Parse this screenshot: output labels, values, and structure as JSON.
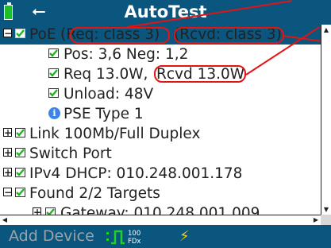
{
  "title_bar": {
    "title": "AutoTest",
    "battery_icon": "battery-icon",
    "usb_icon": "usb-icon",
    "usb_glyph": "⭠"
  },
  "tree": {
    "poe": {
      "expander": "⊟",
      "label": "PoE",
      "req_label": "(Req: class 3)",
      "rcvd_label": "(Rcvd: class 3)"
    },
    "pos_neg": "Pos: 3,6 Neg: 1,2",
    "req_power": "Req 13.0W,",
    "rcvd_power": "Rcvd 13.0W",
    "unload": "Unload: 48V",
    "pse_type": "PSE Type 1",
    "info_glyph": "i",
    "link": "Link 100Mb/Full Duplex",
    "switch_port": "Switch Port",
    "ipv4": "IPv4 DHCP: 010.248.001.178",
    "found_targets": "Found 2/2 Targets",
    "gateway": "Gateway: 010.248.001.009",
    "expander_plus": "+",
    "expander_minus": "−"
  },
  "scrollbars": {
    "up_arrow": "▲",
    "down_arrow": "▼",
    "left_arrow": "◀",
    "right_arrow": "▶"
  },
  "bottom_bar": {
    "add_device_label": "Add Device",
    "speed_top": "100",
    "speed_bottom": "FDx",
    "bolt_glyph": "⚡"
  },
  "colors": {
    "header_bg": "#0b567e",
    "annotation_red": "#e21414",
    "check_green": "#1fb51f",
    "battery_green": "#1fbf2a",
    "bolt_yellow": "#f5d018"
  }
}
